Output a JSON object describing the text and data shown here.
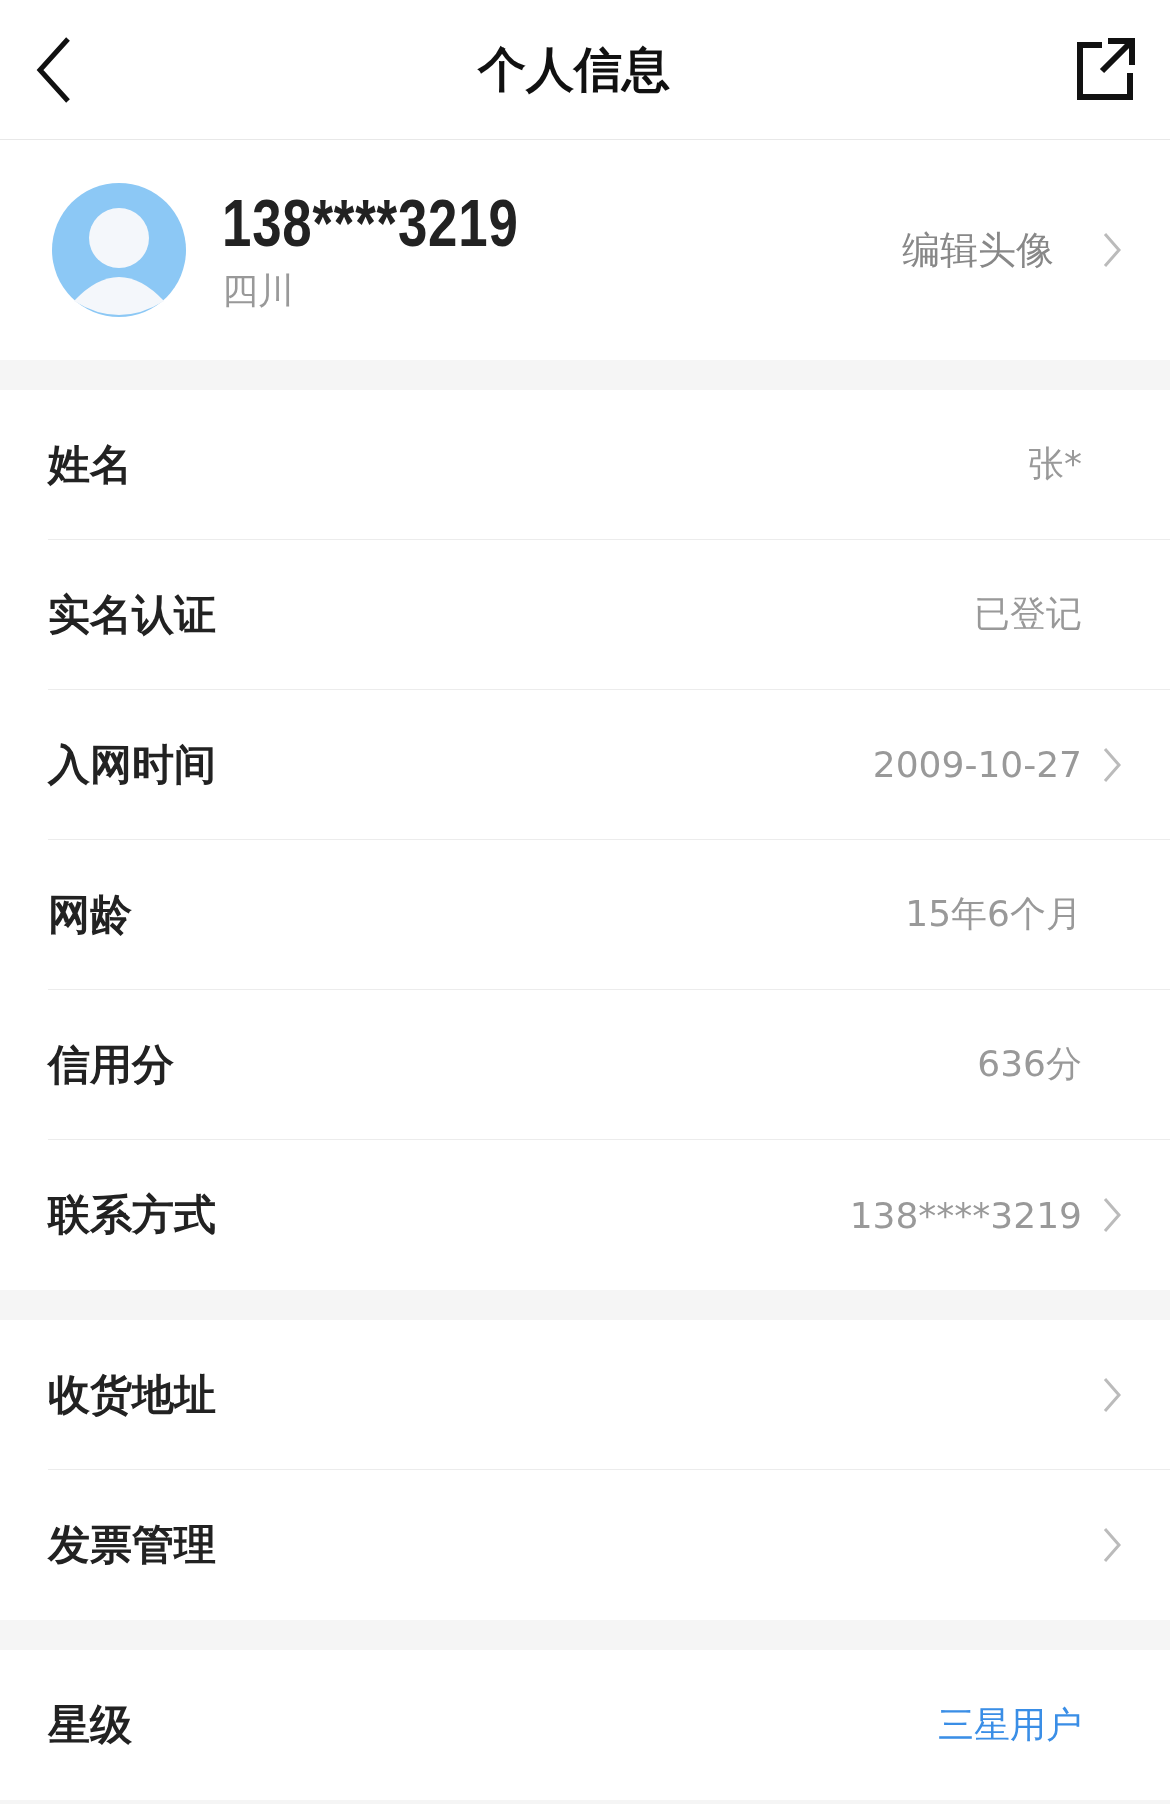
{
  "header": {
    "title": "个人信息"
  },
  "profile": {
    "phone": "138****3219",
    "region": "四川",
    "edit_label": "编辑头像"
  },
  "sections": [
    {
      "rows": [
        {
          "label": "姓名",
          "value": "张*",
          "arrow": false,
          "color": "#999999"
        },
        {
          "label": "实名认证",
          "value": "已登记",
          "arrow": false,
          "color": "#999999"
        },
        {
          "label": "入网时间",
          "value": "2009-10-27",
          "arrow": true,
          "color": "#999999"
        },
        {
          "label": "网龄",
          "value": "15年6个月",
          "arrow": false,
          "color": "#999999"
        },
        {
          "label": "信用分",
          "value": "636分",
          "arrow": false,
          "color": "#999999"
        },
        {
          "label": "联系方式",
          "value": "138****3219",
          "arrow": true,
          "color": "#999999"
        }
      ]
    },
    {
      "rows": [
        {
          "label": "收货地址",
          "arrow": true
        },
        {
          "label": "发票管理",
          "arrow": true
        }
      ]
    },
    {
      "rows": [
        {
          "label": "星级",
          "value": "三星用户",
          "arrow": false,
          "color": "#3a8ee6"
        }
      ]
    }
  ]
}
